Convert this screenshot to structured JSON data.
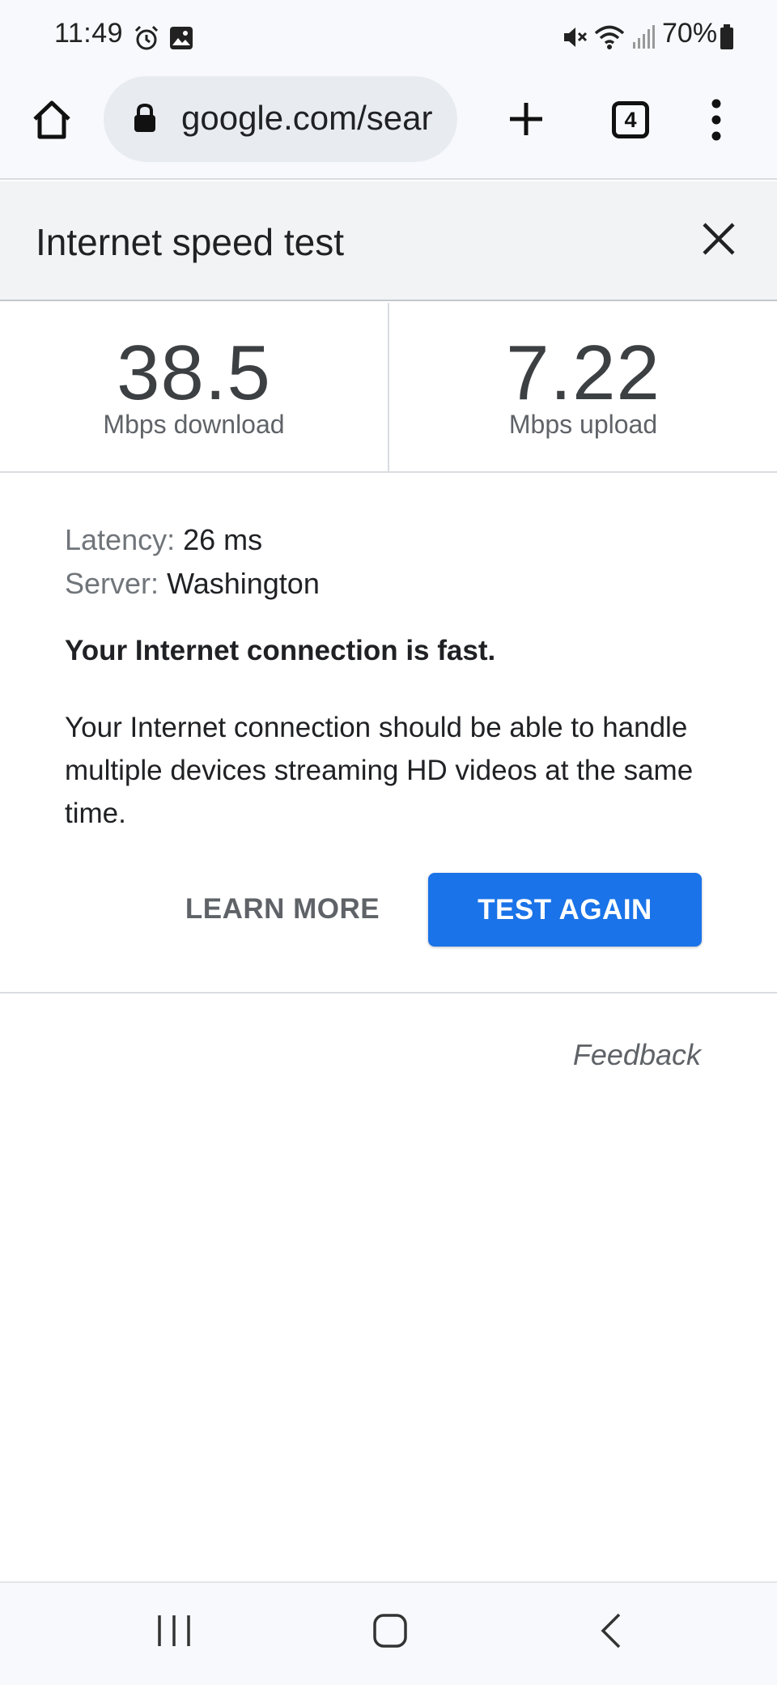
{
  "status_bar": {
    "time": "11:49",
    "battery": "70%",
    "icons": [
      "alarm-icon",
      "gallery-icon",
      "mute-icon",
      "wifi-icon",
      "signal-icon",
      "battery-icon"
    ]
  },
  "toolbar": {
    "url": "google.com/sear",
    "tab_count": "4",
    "icons": [
      "home-icon",
      "lock-icon",
      "plus-icon",
      "tab-switcher-icon",
      "more-vert-icon"
    ]
  },
  "speed_test": {
    "title": "Internet speed test",
    "download": {
      "value": "38.5",
      "unit": "Mbps download"
    },
    "upload": {
      "value": "7.22",
      "unit": "Mbps upload"
    },
    "latency_label": "Latency:",
    "latency_value": "26 ms",
    "server_label": "Server:",
    "server_value": "Washington",
    "summary": "Your Internet connection is fast.",
    "description": "Your Internet connection should be able to handle multiple devices streaming HD videos at the same time.",
    "learn_more": "LEARN MORE",
    "test_again": "TEST AGAIN",
    "feedback": "Feedback"
  },
  "colors": {
    "accent": "#1a73e8",
    "header_bg": "#f1f3f4",
    "omnibox_bg": "#e8ecf1"
  },
  "nav_bar": {
    "icons": [
      "recent-apps-icon",
      "home-nav-icon",
      "back-icon"
    ]
  }
}
